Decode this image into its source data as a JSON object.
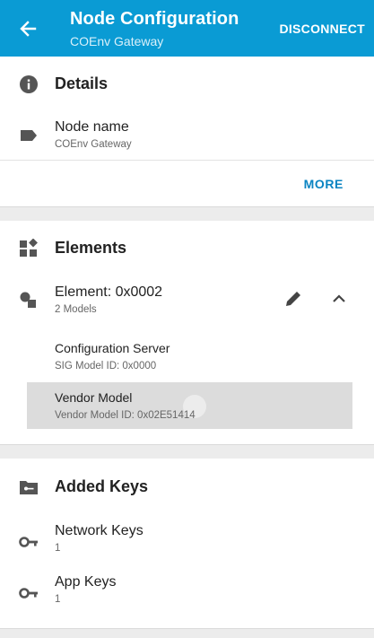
{
  "appbar": {
    "title": "Node Configuration",
    "subtitle": "COEnv Gateway",
    "action": "DISCONNECT",
    "back_icon": "arrow-back-icon"
  },
  "details": {
    "header": "Details",
    "header_icon": "info-icon",
    "node_name_label": "Node name",
    "node_name_value": "COEnv Gateway",
    "node_name_icon": "label-tag-icon",
    "more_label": "MORE"
  },
  "elements": {
    "header": "Elements",
    "header_icon": "widgets-icon",
    "element_title": "Element: 0x0002",
    "element_models": "2 Models",
    "element_icon": "element-shapes-icon",
    "edit_icon": "pencil-icon",
    "collapse_icon": "chevron-up-icon",
    "models": [
      {
        "title": "Configuration Server",
        "sub": "SIG Model ID: 0x0000"
      },
      {
        "title": "Vendor Model",
        "sub": "Vendor Model ID: 0x02E51414"
      }
    ]
  },
  "added_keys": {
    "header": "Added Keys",
    "header_icon": "folder-key-icon",
    "network_keys_label": "Network Keys",
    "network_keys_count": "1",
    "app_keys_label": "App Keys",
    "app_keys_count": "1",
    "key_icon": "key-icon"
  },
  "colors": {
    "appbar": "#0a9bd4",
    "accent": "#0a84c2",
    "background": "#ececec"
  }
}
